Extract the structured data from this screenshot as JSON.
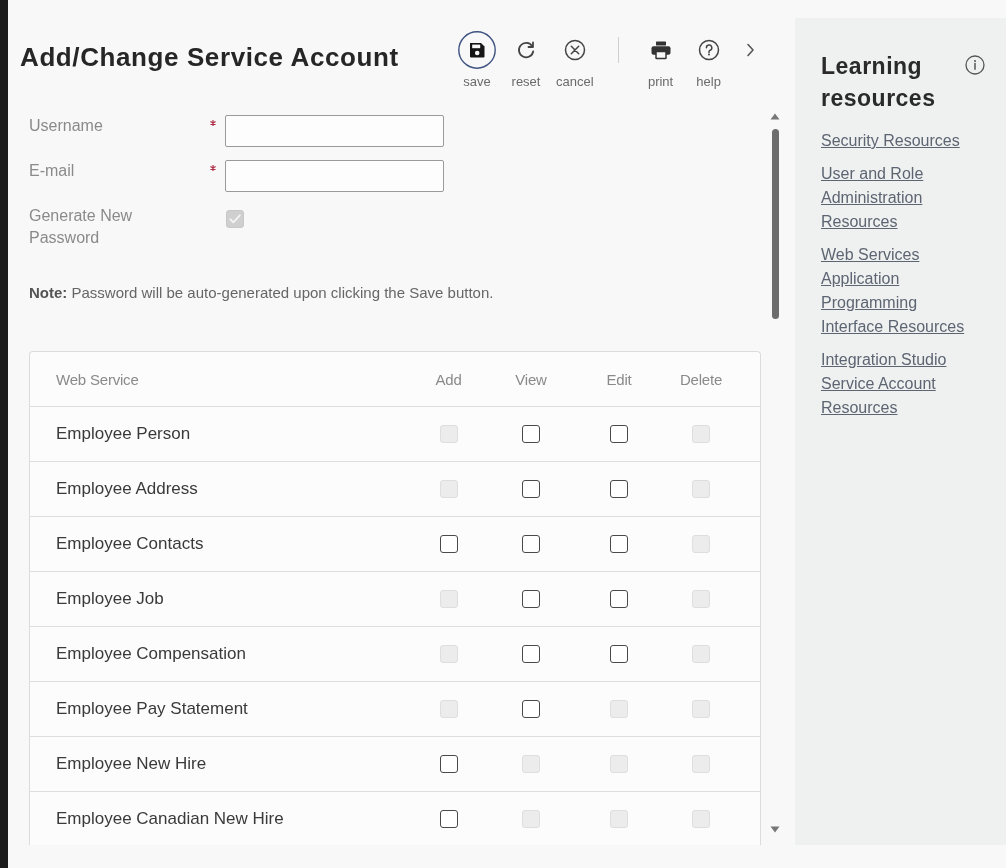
{
  "page": {
    "title": "Add/Change Service Account"
  },
  "toolbar": {
    "groups": [
      [
        {
          "kind": "save",
          "label": "save",
          "focused": true
        },
        {
          "kind": "reset",
          "label": "reset",
          "focused": false
        },
        {
          "kind": "cancel",
          "label": "cancel",
          "focused": false
        }
      ],
      [
        {
          "kind": "print",
          "label": "print",
          "focused": false
        },
        {
          "kind": "help",
          "label": "help",
          "focused": false
        },
        {
          "kind": "more",
          "focused": false
        }
      ]
    ]
  },
  "form": {
    "fields": [
      {
        "kind": "text",
        "label": "Username",
        "required": true,
        "disabled": false
      },
      {
        "kind": "text",
        "label": "E-mail",
        "required": true,
        "disabled": false
      },
      {
        "kind": "checkbox",
        "label": "Generate New Password",
        "required": false,
        "disabled": true,
        "checked": true
      }
    ],
    "note": "**Note:** Password will be auto-generated upon clicking the Save button."
  },
  "table": {
    "columns": [
      "Web Service",
      "Add",
      "View",
      "Edit",
      "Delete"
    ],
    "rows": [
      {
        "name": "Employee Person",
        "permissions": [
          {
            "checked": false,
            "disabled": true
          },
          {
            "checked": false,
            "disabled": false
          },
          {
            "checked": false,
            "disabled": false
          },
          {
            "checked": false,
            "disabled": true
          }
        ]
      },
      {
        "name": "Employee Address",
        "permissions": [
          {
            "checked": false,
            "disabled": true
          },
          {
            "checked": false,
            "disabled": false
          },
          {
            "checked": false,
            "disabled": false
          },
          {
            "checked": false,
            "disabled": true
          }
        ]
      },
      {
        "name": "Employee Contacts",
        "permissions": [
          {
            "checked": false,
            "disabled": false
          },
          {
            "checked": false,
            "disabled": false
          },
          {
            "checked": false,
            "disabled": false
          },
          {
            "checked": false,
            "disabled": true
          }
        ]
      },
      {
        "name": "Employee Job",
        "permissions": [
          {
            "checked": false,
            "disabled": true
          },
          {
            "checked": false,
            "disabled": false
          },
          {
            "checked": false,
            "disabled": false
          },
          {
            "checked": false,
            "disabled": true
          }
        ]
      },
      {
        "name": "Employee Compensation",
        "permissions": [
          {
            "checked": false,
            "disabled": true
          },
          {
            "checked": false,
            "disabled": false
          },
          {
            "checked": false,
            "disabled": false
          },
          {
            "checked": false,
            "disabled": true
          }
        ]
      },
      {
        "name": "Employee Pay Statement",
        "permissions": [
          {
            "checked": false,
            "disabled": true
          },
          {
            "checked": false,
            "disabled": false
          },
          {
            "checked": false,
            "disabled": true
          },
          {
            "checked": false,
            "disabled": true
          }
        ]
      },
      {
        "name": "Employee New Hire",
        "permissions": [
          {
            "checked": false,
            "disabled": false
          },
          {
            "checked": false,
            "disabled": true
          },
          {
            "checked": false,
            "disabled": true
          },
          {
            "checked": false,
            "disabled": true
          }
        ]
      },
      {
        "name": "Employee Canadian New Hire",
        "permissions": [
          {
            "checked": false,
            "disabled": false
          },
          {
            "checked": false,
            "disabled": true
          },
          {
            "checked": false,
            "disabled": true
          },
          {
            "checked": false,
            "disabled": true
          }
        ]
      }
    ]
  },
  "sidebar": {
    "title": "Learning resources",
    "links": [
      "Security Resources",
      "User and Role Administration Resources",
      "Web Services Application Programming Interface Resources",
      "Integration Studio Service Account Resources"
    ]
  }
}
